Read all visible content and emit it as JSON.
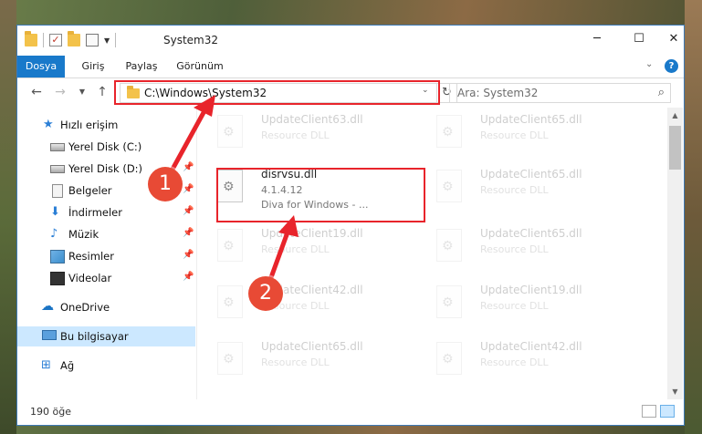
{
  "window": {
    "title": "System32",
    "controls": {
      "minimize": "─",
      "maximize": "☐",
      "close": "✕"
    }
  },
  "ribbon": {
    "tabs": [
      {
        "label": "Dosya",
        "active": true
      },
      {
        "label": "Giriş"
      },
      {
        "label": "Paylaş"
      },
      {
        "label": "Görünüm"
      }
    ],
    "help": "?"
  },
  "nav": {
    "address": "C:\\Windows\\System32",
    "search_placeholder": "Ara: System32"
  },
  "sidebar": {
    "items": [
      {
        "label": "Hızlı erişim",
        "icon": "star-icon",
        "pinned": false
      },
      {
        "label": "Yerel Disk (C:)",
        "icon": "disk-icon",
        "pinned": false
      },
      {
        "label": "Yerel Disk (D:)",
        "icon": "disk-icon",
        "pinned": true
      },
      {
        "label": "Belgeler",
        "icon": "document-icon",
        "pinned": true
      },
      {
        "label": "İndirmeler",
        "icon": "download-icon",
        "pinned": true
      },
      {
        "label": "Müzik",
        "icon": "music-icon",
        "pinned": true
      },
      {
        "label": "Resimler",
        "icon": "pictures-icon",
        "pinned": true
      },
      {
        "label": "Videolar",
        "icon": "video-icon",
        "pinned": true
      },
      {
        "label": "OneDrive",
        "icon": "cloud-icon",
        "pinned": false
      },
      {
        "label": "Bu bilgisayar",
        "icon": "computer-icon",
        "pinned": false,
        "selected": true
      },
      {
        "label": "Ağ",
        "icon": "network-icon",
        "pinned": false
      }
    ]
  },
  "files": [
    {
      "name": "UpdateClient63.dll",
      "desc": "Resource DLL",
      "faded": true
    },
    {
      "name": "UpdateClient65.dll",
      "desc": "Resource DLL",
      "faded": true
    },
    {
      "name": "disrvsu.dll",
      "version": "4.1.4.12",
      "desc": "Diva for Windows - ...",
      "faded": false
    },
    {
      "name": "UpdateClient65.dll",
      "desc": "Resource DLL",
      "faded": true
    },
    {
      "name": "UpdateClient19.dll",
      "desc": "Resource DLL",
      "faded": true
    },
    {
      "name": "UpdateClient65.dll",
      "desc": "Resource DLL",
      "faded": true
    },
    {
      "name": "UpdateClient42.dll",
      "desc": "Resource DLL",
      "faded": true
    },
    {
      "name": "UpdateClient19.dll",
      "desc": "Resource DLL",
      "faded": true
    },
    {
      "name": "UpdateClient65.dll",
      "desc": "Resource DLL",
      "faded": true
    },
    {
      "name": "UpdateClient42.dll",
      "desc": "Resource DLL",
      "faded": true
    }
  ],
  "status": {
    "item_count": "190 öğe"
  },
  "annotations": {
    "badge1": "1",
    "badge2": "2",
    "color": "#e8242b"
  }
}
